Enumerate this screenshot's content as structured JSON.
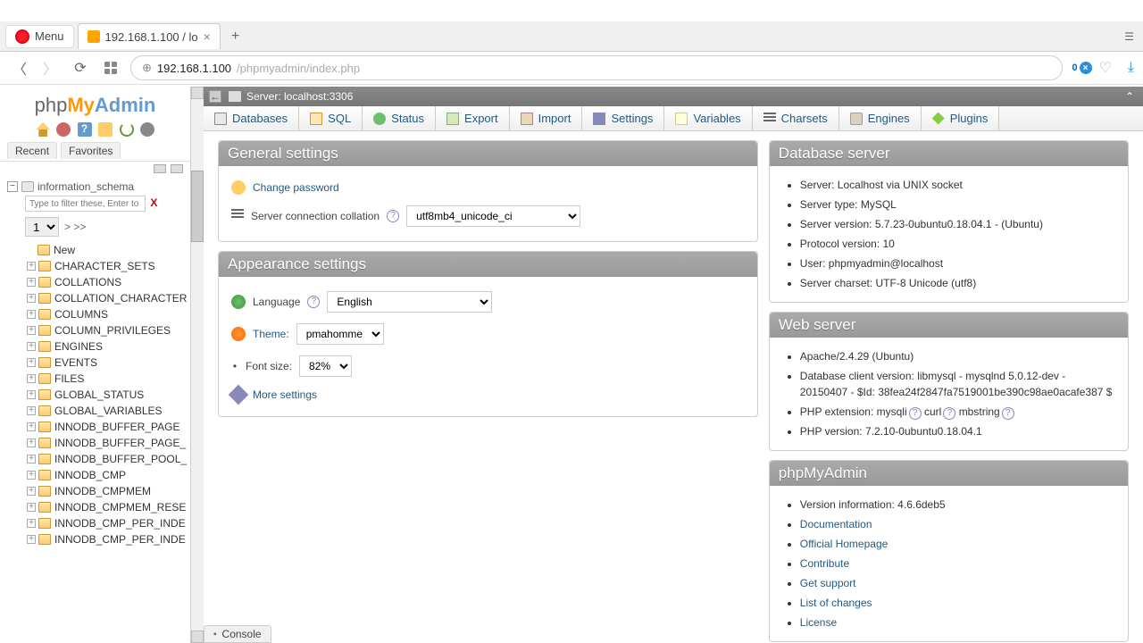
{
  "browser": {
    "menu_label": "Menu",
    "tab_title": "192.168.1.100 / lo",
    "url_host": "192.168.1.100",
    "url_path": "/phpmyadmin/index.php",
    "blocker_count": "0"
  },
  "logo": {
    "php": "php",
    "my": "My",
    "admin": "Admin"
  },
  "sidebar": {
    "recent": "Recent",
    "favorites": "Favorites",
    "db": "information_schema",
    "filter_placeholder": "Type to filter these, Enter to searc",
    "page_value": "1",
    "page_nav": "> >>",
    "new": "New",
    "tables": [
      "CHARACTER_SETS",
      "COLLATIONS",
      "COLLATION_CHARACTER",
      "COLUMNS",
      "COLUMN_PRIVILEGES",
      "ENGINES",
      "EVENTS",
      "FILES",
      "GLOBAL_STATUS",
      "GLOBAL_VARIABLES",
      "INNODB_BUFFER_PAGE",
      "INNODB_BUFFER_PAGE_",
      "INNODB_BUFFER_POOL_",
      "INNODB_CMP",
      "INNODB_CMPMEM",
      "INNODB_CMPMEM_RESE",
      "INNODB_CMP_PER_INDE",
      "INNODB_CMP_PER_INDE"
    ]
  },
  "server_bar": "Server: localhost:3306",
  "topmenu": [
    "Databases",
    "SQL",
    "Status",
    "Export",
    "Import",
    "Settings",
    "Variables",
    "Charsets",
    "Engines",
    "Plugins"
  ],
  "general": {
    "title": "General settings",
    "change_pw": "Change password",
    "collation_label": "Server connection collation",
    "collation_value": "utf8mb4_unicode_ci"
  },
  "appearance": {
    "title": "Appearance settings",
    "lang_label": "Language",
    "lang_value": "English",
    "theme_label": "Theme:",
    "theme_value": "pmahomme",
    "fontsize_label": "Font size:",
    "fontsize_value": "82%",
    "more": "More settings"
  },
  "dbserver": {
    "title": "Database server",
    "items": [
      "Server: Localhost via UNIX socket",
      "Server type: MySQL",
      "Server version: 5.7.23-0ubuntu0.18.04.1 - (Ubuntu)",
      "Protocol version: 10",
      "User: phpmyadmin@localhost",
      "Server charset: UTF-8 Unicode (utf8)"
    ]
  },
  "webserver": {
    "title": "Web server",
    "apache": "Apache/2.4.29 (Ubuntu)",
    "dbclient": "Database client version: libmysql - mysqlnd 5.0.12-dev - 20150407 - $Id: 38fea24f2847fa7519001be390c98ae0acafe387 $",
    "phpext_label": "PHP extension:",
    "phpext_1": "mysqli",
    "phpext_2": "curl",
    "phpext_3": "mbstring",
    "phpver": "PHP version: 7.2.10-0ubuntu0.18.04.1"
  },
  "pma_panel": {
    "title": "phpMyAdmin",
    "version": "Version information: 4.6.6deb5",
    "links": [
      "Documentation",
      "Official Homepage",
      "Contribute",
      "Get support",
      "List of changes",
      "License"
    ]
  },
  "console": "Console"
}
